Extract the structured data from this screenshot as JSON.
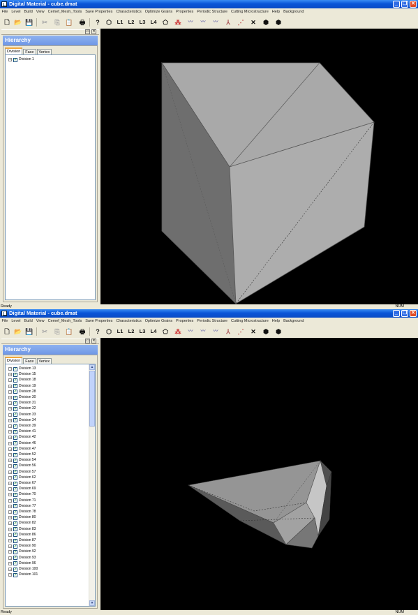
{
  "colors": {
    "titlebar": "#0a56d8",
    "viewport_bg": "#000000",
    "panel_bg": "#ece9d8",
    "hierarchy_header": "#7ba2ea",
    "face_light": "#a9a9a9",
    "face_dark": "#6e6e6e"
  },
  "window1": {
    "title": "Digital Material - cube.dmat",
    "hierarchy": {
      "title": "Hierarchy",
      "tabs": [
        "Division",
        "Face",
        "Vertex"
      ],
      "tree": [
        "Division 1"
      ]
    },
    "status": {
      "left": "Ready",
      "right": "NUM"
    }
  },
  "window2": {
    "title": "Digital Material - cube.dmat",
    "hierarchy": {
      "title": "Hierarchy",
      "tabs": [
        "Division",
        "Face",
        "Vertex"
      ],
      "tree": [
        "Division 13",
        "Division 15",
        "Division 18",
        "Division 19",
        "Division 28",
        "Division 30",
        "Division 31",
        "Division 32",
        "Division 33",
        "Division 34",
        "Division 39",
        "Division 41",
        "Division 42",
        "Division 46",
        "Division 47",
        "Division 52",
        "Division 54",
        "Division 56",
        "Division 57",
        "Division 62",
        "Division 67",
        "Division 69",
        "Division 70",
        "Division 71",
        "Division 77",
        "Division 78",
        "Division 80",
        "Division 82",
        "Division 83",
        "Division 86",
        "Division 87",
        "Division 90",
        "Division 92",
        "Division 93",
        "Division 96",
        "Division 100",
        "Division 101"
      ]
    },
    "status": {
      "left": "Ready",
      "right": "NUM"
    }
  },
  "menu": [
    "File",
    "Level",
    "Build",
    "View",
    "Cemef_Mesh_Tools",
    "Save Properties",
    "Characteristics",
    "Optimize Grains",
    "Properties",
    "Periodic Structure",
    "Cutting Microstructure",
    "Help",
    "Background"
  ],
  "toolbar": {
    "icons": [
      "new-file-icon",
      "open-folder-icon",
      "save-icon",
      "cut-icon",
      "copy-icon",
      "paste-icon",
      "print-icon",
      "help-icon",
      "level-icon",
      "level-1-icon",
      "level-2-icon",
      "level-3-icon",
      "level-4-icon",
      "shape-icon",
      "color-dots-icon",
      "measure-1-icon",
      "measure-2-icon",
      "measure-3-icon",
      "axis-icon",
      "vertex-icon",
      "scissors-icon",
      "grain-icon",
      "grain-alt-icon"
    ],
    "level_labels": [
      "L1",
      "L2",
      "L3",
      "L4"
    ]
  },
  "window_controls": [
    "minimize",
    "maximize",
    "close"
  ]
}
